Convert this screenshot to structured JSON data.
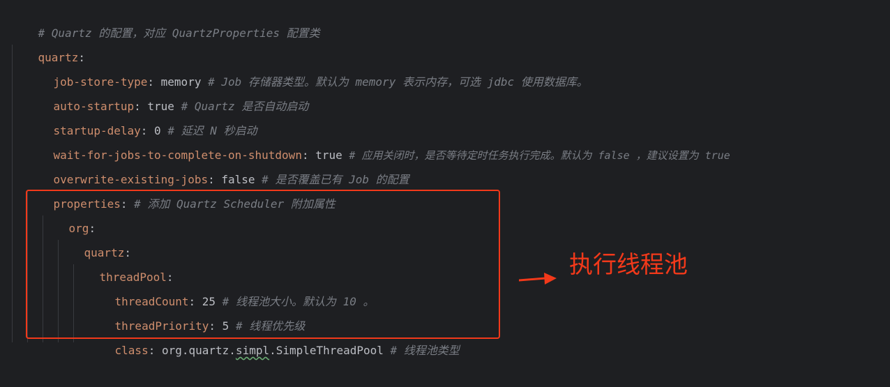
{
  "code": {
    "l1_comment": "# Quartz 的配置，对应 QuartzProperties 配置类",
    "l2_key": "quartz",
    "l3_key": "job-store-type",
    "l3_value": "memory",
    "l3_comment": "# Job 存储器类型。默认为 memory 表示内存，可选 jdbc 使用数据库。",
    "l4_key": "auto-startup",
    "l4_value": "true",
    "l4_comment": "# Quartz 是否自动启动",
    "l5_key": "startup-delay",
    "l5_value": "0",
    "l5_comment": "# 延迟 N 秒启动",
    "l6_key": "wait-for-jobs-to-complete-on-shutdown",
    "l6_value": "true",
    "l6_comment": "# 应用关闭时，是否等待定时任务执行完成。默认为 false ，建议设置为 true",
    "l7_key": "overwrite-existing-jobs",
    "l7_value": "false",
    "l7_comment": "# 是否覆盖已有 Job 的配置",
    "l8_key": "properties",
    "l8_comment": "# 添加 Quartz Scheduler 附加属性",
    "l9_key": "org",
    "l10_key": "quartz",
    "l11_key": "threadPool",
    "l12_key": "threadCount",
    "l12_value": "25",
    "l12_comment": "# 线程池大小。默认为 10 。",
    "l13_key": "threadPriority",
    "l13_value": "5",
    "l13_comment": "# 线程优先级",
    "l14_key": "class",
    "l14_value_a": "org.quartz.",
    "l14_value_b": "simpl",
    "l14_value_c": ".SimpleThreadPool",
    "l14_comment": "# 线程池类型"
  },
  "annotation": {
    "text": "执行线程池"
  },
  "colors": {
    "highlight": "#f2391a",
    "key": "#cf8e6d",
    "comment": "#7a7e85",
    "background": "#1e1f22"
  }
}
